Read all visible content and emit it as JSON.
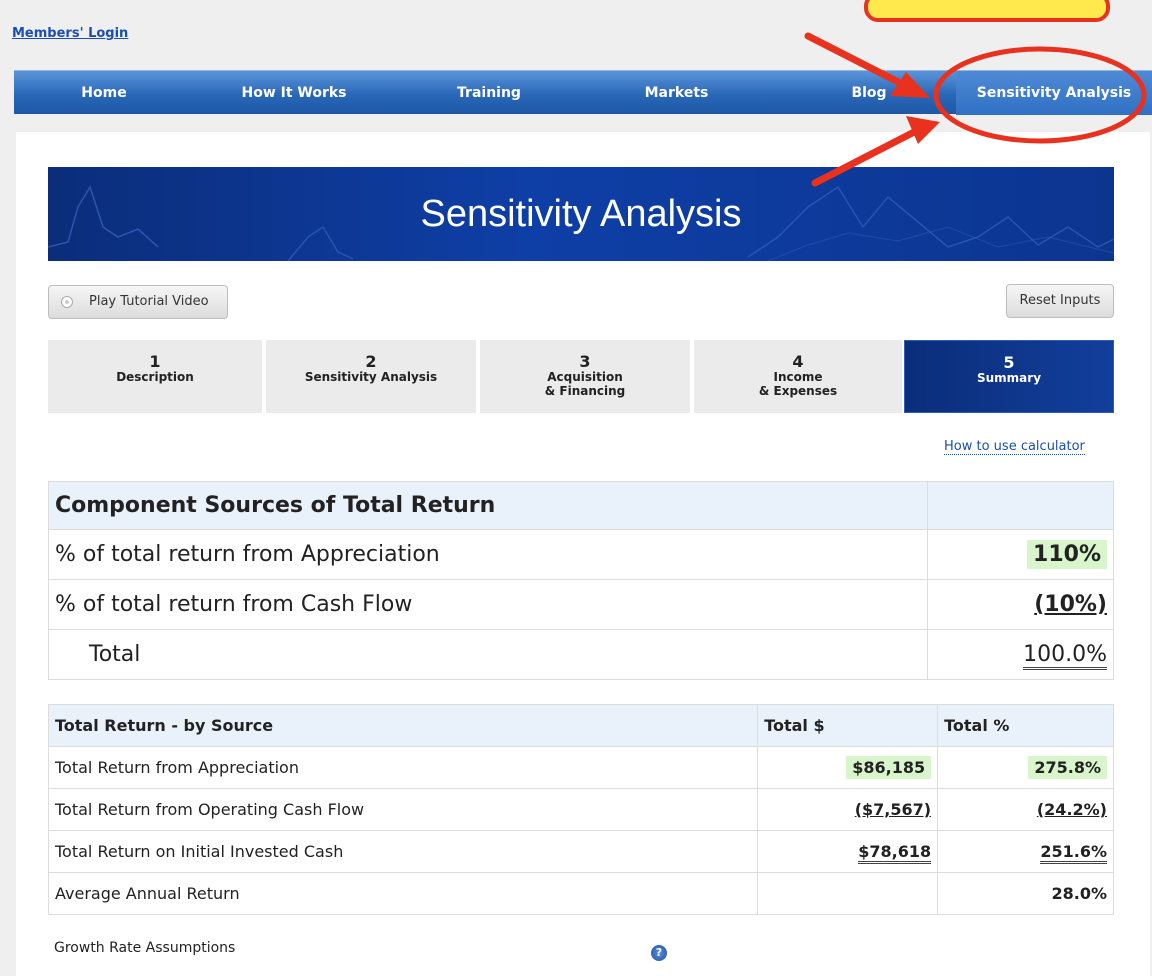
{
  "header": {
    "members_login": "Members' Login"
  },
  "nav": {
    "items": [
      {
        "label": "Home"
      },
      {
        "label": "How It Works"
      },
      {
        "label": "Training"
      },
      {
        "label": "Markets"
      },
      {
        "label": "Blog"
      },
      {
        "label": "Sensitivity Analysis"
      }
    ]
  },
  "banner": {
    "title": "Sensitivity Analysis"
  },
  "toolbar": {
    "play_label": "Play Tutorial Video",
    "reset_label": "Reset Inputs"
  },
  "steps": [
    {
      "num": "1",
      "label": "Description"
    },
    {
      "num": "2",
      "label": "Sensitivity Analysis"
    },
    {
      "num": "3",
      "label": "Acquisition\n& Financing"
    },
    {
      "num": "4",
      "label": "Income\n& Expenses"
    },
    {
      "num": "5",
      "label": "Summary"
    }
  ],
  "help_link": "How to use calculator",
  "components": {
    "title": "Component Sources of Total Return",
    "rows": [
      {
        "label": "% of total return from Appreciation",
        "value": "110%"
      },
      {
        "label": "% of total return from Cash Flow",
        "value": "(10%)"
      },
      {
        "label": "Total",
        "value": "100.0%"
      }
    ]
  },
  "by_source": {
    "headers": [
      "Total Return - by Source",
      "Total $",
      "Total %"
    ],
    "rows": [
      {
        "label": "Total Return from Appreciation",
        "dollars": "$86,185",
        "percent": "275.8%"
      },
      {
        "label": "Total Return from Operating Cash Flow",
        "dollars": "($7,567)",
        "percent": "(24.2%)"
      },
      {
        "label": "Total Return on Initial Invested Cash",
        "dollars": "$78,618",
        "percent": "251.6%"
      },
      {
        "label": "Average Annual Return",
        "dollars": "",
        "percent": "28.0%"
      }
    ]
  },
  "growth": {
    "label": "Growth Rate Assumptions",
    "help_icon": "?"
  },
  "colors": {
    "nav_blue": "#2a67b8",
    "banner_navy": "#0b2d7a",
    "highlight_green": "#d8f5cc",
    "annotation_red": "#e8321e",
    "link_blue": "#1a4fb0"
  }
}
